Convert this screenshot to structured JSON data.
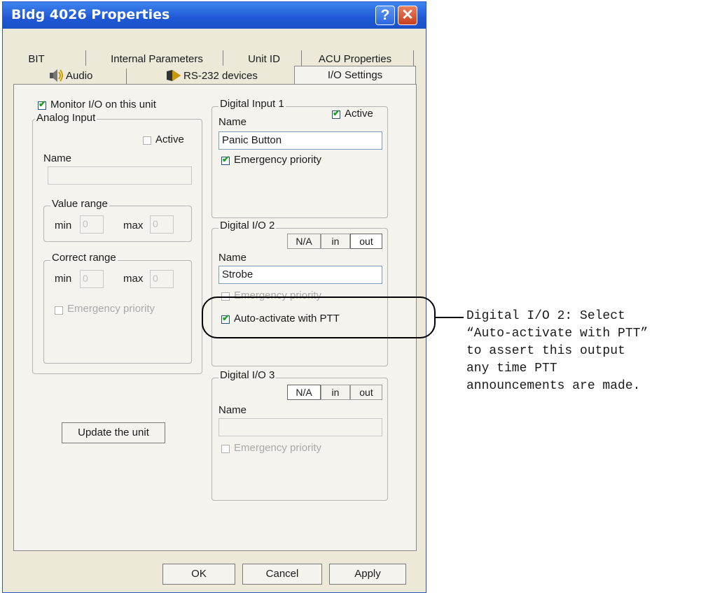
{
  "window": {
    "title": "Bldg 4026 Properties",
    "help_glyph": "?",
    "close_glyph": "✕"
  },
  "tabs_row1": [
    "BIT",
    "Internal Parameters",
    "Unit ID",
    "ACU Properties"
  ],
  "tabs_row2": [
    "Audio",
    "RS-232 devices",
    "I/O Settings"
  ],
  "monitor": {
    "label": "Monitor I/O on this unit",
    "checked": true
  },
  "analog_input": {
    "legend": "Analog Input",
    "active_label": "Active",
    "active_checked": false,
    "name_label": "Name",
    "name_value": "",
    "value_range": {
      "legend": "Value range",
      "min_label": "min",
      "min_value": "0",
      "max_label": "max",
      "max_value": "0"
    },
    "correct_range": {
      "legend": "Correct range",
      "min_label": "min",
      "min_value": "0",
      "max_label": "max",
      "max_value": "0"
    },
    "emergency_label": "Emergency priority"
  },
  "digital_input_1": {
    "legend": "Digital Input 1",
    "active_label": "Active",
    "active_checked": true,
    "name_label": "Name",
    "name_value": "Panic Button",
    "emergency_label": "Emergency priority",
    "emergency_checked": true
  },
  "digital_io_2": {
    "legend": "Digital I/O 2",
    "modes": [
      "N/A",
      "in",
      "out"
    ],
    "selected_mode": "out",
    "name_label": "Name",
    "name_value": "Strobe",
    "emergency_label": "Emergency priority",
    "auto_label": "Auto-activate with PTT",
    "auto_checked": true
  },
  "digital_io_3": {
    "legend": "Digital I/O 3",
    "modes": [
      "N/A",
      "in",
      "out"
    ],
    "selected_mode": "N/A",
    "name_label": "Name",
    "name_value": "",
    "emergency_label": "Emergency priority"
  },
  "update_button": "Update the unit",
  "footer_buttons": {
    "ok": "OK",
    "cancel": "Cancel",
    "apply": "Apply"
  },
  "callout": "Digital I/O 2: Select\n“Auto-activate with PTT”\nto assert this output\nany time PTT\nannouncements are made."
}
